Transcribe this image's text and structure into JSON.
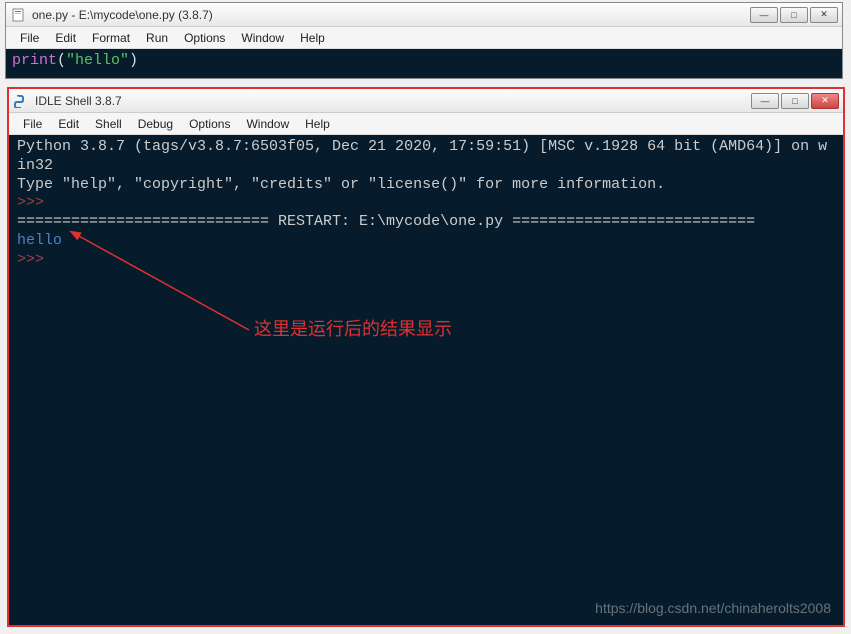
{
  "editor_window": {
    "title": "one.py - E:\\mycode\\one.py (3.8.7)",
    "menus": [
      "File",
      "Edit",
      "Format",
      "Run",
      "Options",
      "Window",
      "Help"
    ],
    "code": {
      "keyword": "print",
      "open_paren": "(",
      "string": "\"hello\"",
      "close_paren": ")"
    },
    "controls": {
      "minimize": "—",
      "maximize": "□",
      "close": "✕"
    }
  },
  "shell_window": {
    "title": "IDLE Shell 3.8.7",
    "menus": [
      "File",
      "Edit",
      "Shell",
      "Debug",
      "Options",
      "Window",
      "Help"
    ],
    "banner_line1": "Python 3.8.7 (tags/v3.8.7:6503f05, Dec 21 2020, 17:59:51) [MSC v.1928 64 bit (AMD64)] on win32",
    "banner_line2": "Type \"help\", \"copyright\", \"credits\" or \"license()\" for more information.",
    "prompt": ">>>",
    "restart_line": "============================ RESTART: E:\\mycode\\one.py ===========================",
    "output": "hello",
    "controls": {
      "minimize": "—",
      "maximize": "□",
      "close": "✕"
    }
  },
  "annotation_text": "这里是运行后的结果显示",
  "watermark": "https://blog.csdn.net/chinaherolts2008"
}
